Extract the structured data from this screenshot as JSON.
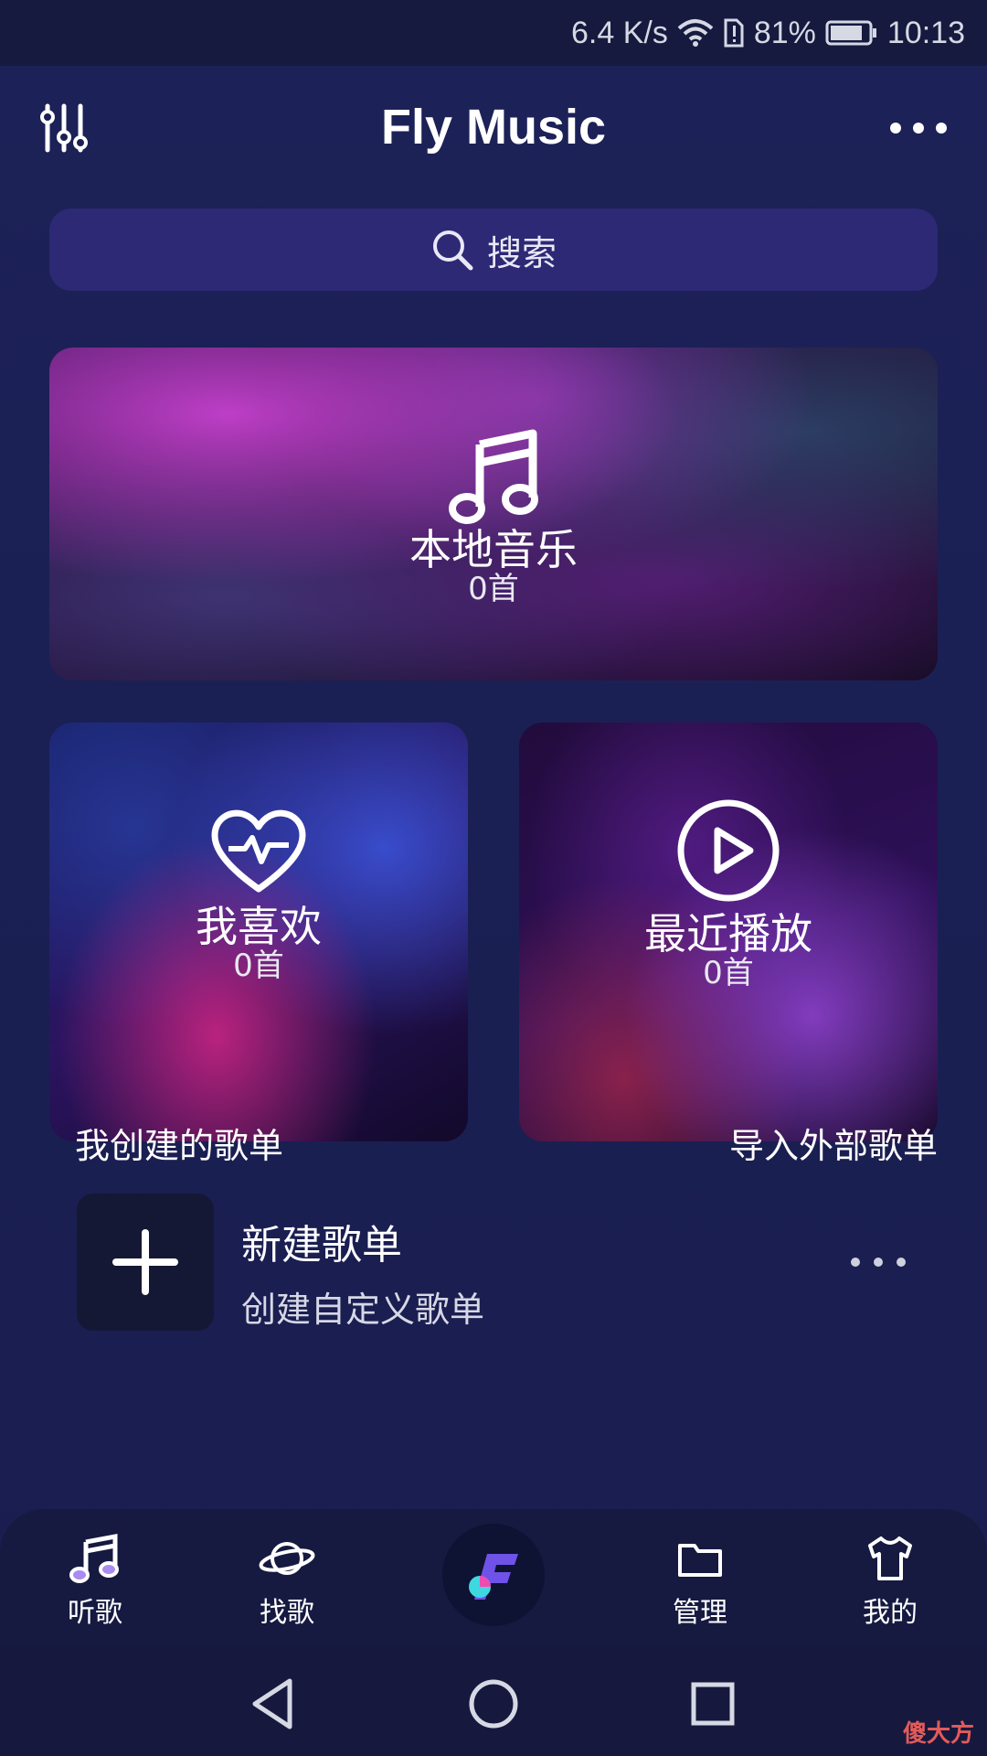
{
  "status_bar": {
    "speed": "6.4 K/s",
    "battery_percent": "81%",
    "time": "10:13"
  },
  "header": {
    "title": "Fly Music"
  },
  "search": {
    "placeholder": "搜索"
  },
  "cards": {
    "local": {
      "label": "本地音乐",
      "count": "0首"
    },
    "favorites": {
      "label": "我喜欢",
      "count": "0首"
    },
    "recent": {
      "label": "最近播放",
      "count": "0首"
    }
  },
  "sections": {
    "my_playlists": "我创建的歌单",
    "import_playlists": "导入外部歌单"
  },
  "new_playlist": {
    "title": "新建歌单",
    "subtitle": "创建自定义歌单"
  },
  "bottom_nav": {
    "items": [
      {
        "label": "听歌",
        "icon": "music-note-icon"
      },
      {
        "label": "找歌",
        "icon": "planet-icon"
      },
      {
        "label": "",
        "icon": "fly-music-logo"
      },
      {
        "label": "管理",
        "icon": "folder-icon"
      },
      {
        "label": "我的",
        "icon": "shirt-icon"
      }
    ]
  },
  "watermark": "傻大方",
  "colors": {
    "background": "#1b1f52",
    "search_bg": "#2d2975",
    "accent_purple": "#a98cf0",
    "accent_cyan": "#3ed8e0",
    "accent_pink": "#f04bb0"
  }
}
